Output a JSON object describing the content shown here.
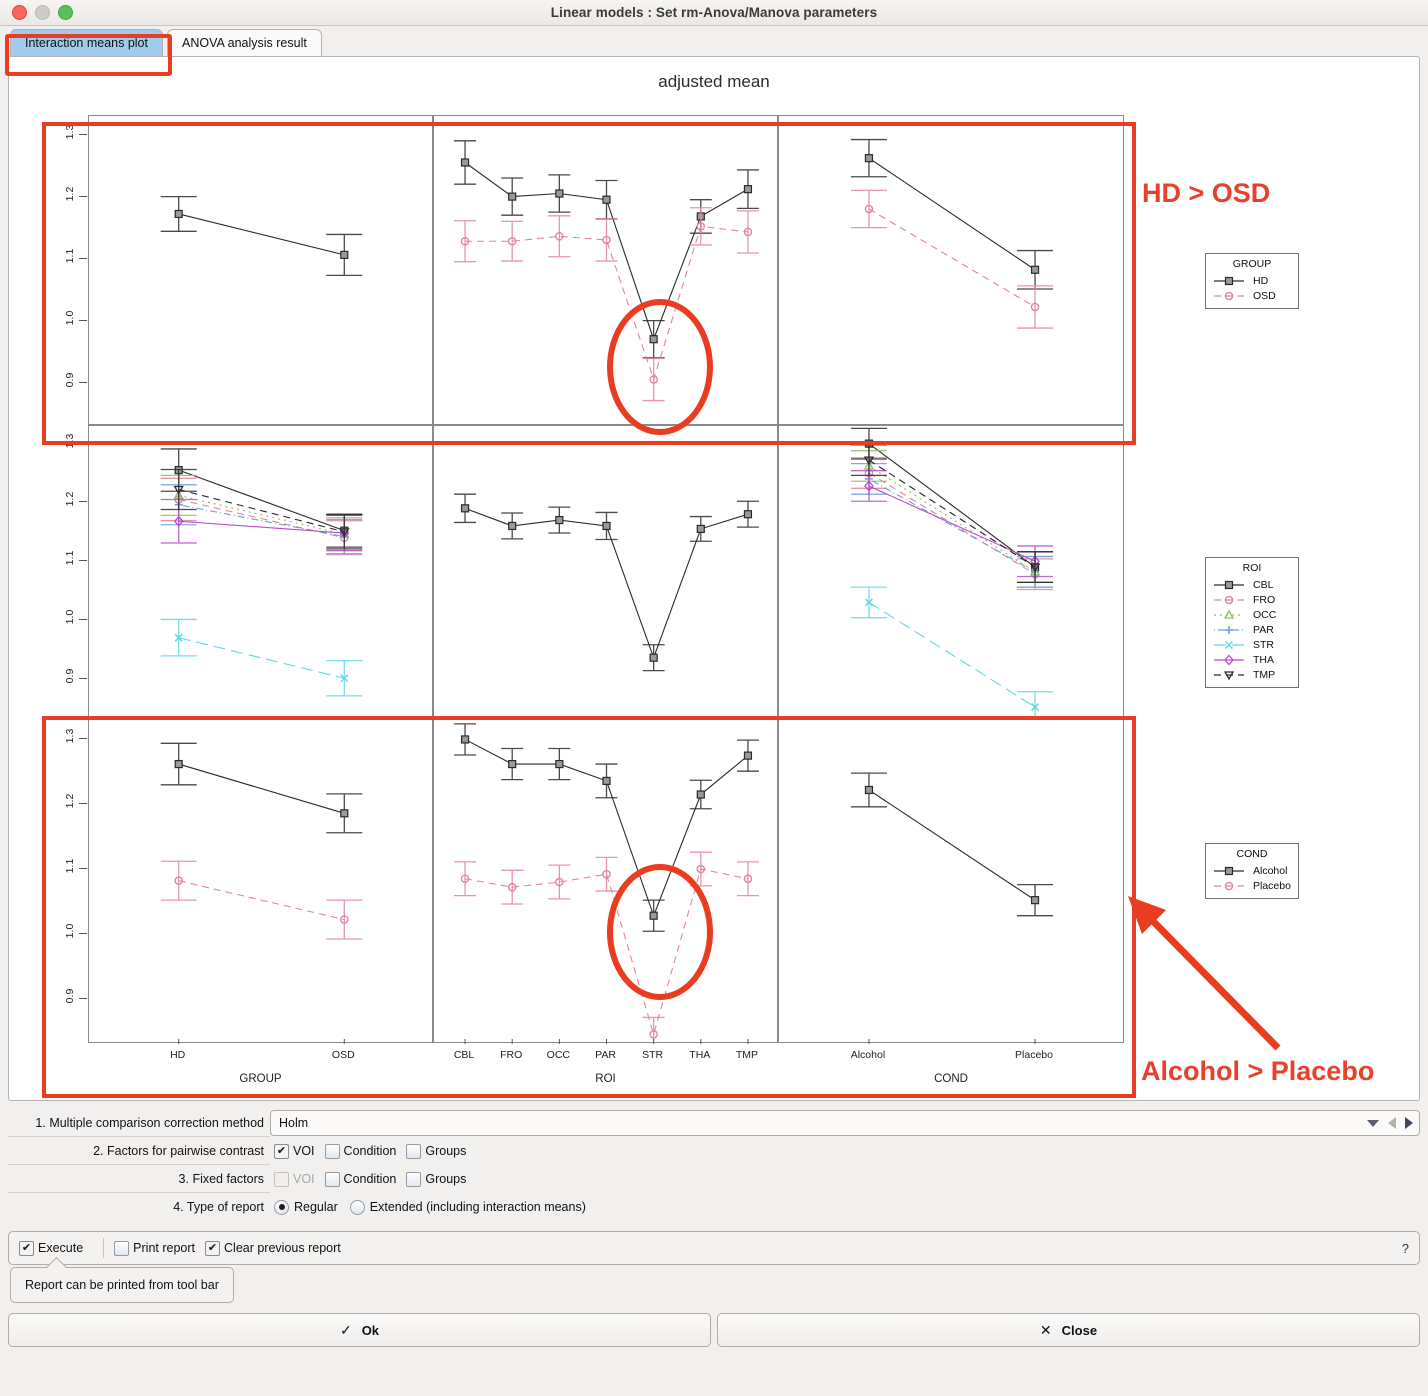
{
  "window": {
    "title": "Linear models :  Set rm-Anova/Manova parameters",
    "traffic": {
      "close": "close-button",
      "minimize": "minimize-button",
      "zoom": "zoom-button"
    }
  },
  "tabs": [
    {
      "label": "Interaction means plot",
      "active": true
    },
    {
      "label": "ANOVA analysis result",
      "active": false
    }
  ],
  "annotations": {
    "hd_osd": "HD > OSD",
    "alcohol_placebo": "Alcohol > Placebo"
  },
  "chart_data": {
    "type": "line",
    "title": "adjusted mean",
    "ylabel": "",
    "ylim": [
      0.83,
      1.33
    ],
    "yticks": [
      "0.9",
      "1.0",
      "1.1",
      "1.2",
      "1.3"
    ],
    "ytick_values": [
      0.9,
      1.0,
      1.1,
      1.2,
      1.3
    ],
    "grid": false,
    "columns": [
      {
        "name": "GROUP",
        "categories": [
          "HD",
          "OSD"
        ]
      },
      {
        "name": "ROI",
        "categories": [
          "CBL",
          "FRO",
          "OCC",
          "PAR",
          "STR",
          "THA",
          "TMP"
        ]
      },
      {
        "name": "COND",
        "categories": [
          "Alcohol",
          "Placebo"
        ]
      }
    ],
    "rows": [
      {
        "legend": {
          "title": "GROUP",
          "position": "right",
          "entries": [
            {
              "name": "HD",
              "color": "#2a2a2a",
              "marker": "square",
              "dash": "solid"
            },
            {
              "name": "OSD",
              "color": "#e2849f",
              "marker": "circle",
              "dash": "dashed"
            }
          ]
        },
        "panels": [
          {
            "x": "GROUP",
            "series": [
              {
                "name": "HD",
                "values": [
                  1.172,
                  1.106
                ],
                "err": [
                  0.028,
                  0.033
                ]
              }
            ]
          },
          {
            "x": "ROI",
            "series": [
              {
                "name": "HD",
                "values": [
                  1.255,
                  1.2,
                  1.205,
                  1.195,
                  0.97,
                  1.168,
                  1.212
                ],
                "err": [
                  0.035,
                  0.03,
                  0.03,
                  0.031,
                  0.03,
                  0.027,
                  0.031
                ]
              },
              {
                "name": "OSD",
                "values": [
                  1.128,
                  1.128,
                  1.136,
                  1.13,
                  0.905,
                  1.152,
                  1.143
                ],
                "err": [
                  0.033,
                  0.032,
                  0.033,
                  0.034,
                  0.034,
                  0.03,
                  0.034
                ]
              }
            ]
          },
          {
            "x": "COND",
            "series": [
              {
                "name": "HD",
                "values": [
                  1.262,
                  1.082
                ],
                "err": [
                  0.03,
                  0.031
                ]
              },
              {
                "name": "OSD",
                "values": [
                  1.18,
                  1.022
                ],
                "err": [
                  0.03,
                  0.034
                ]
              }
            ]
          }
        ]
      },
      {
        "legend": {
          "title": "ROI",
          "position": "right",
          "entries": [
            {
              "name": "CBL",
              "color": "#2a2a2a",
              "marker": "square",
              "dash": "solid"
            },
            {
              "name": "FRO",
              "color": "#e2849f",
              "marker": "circle",
              "dash": "dashed"
            },
            {
              "name": "OCC",
              "color": "#8fbf62",
              "marker": "triangle",
              "dash": "dotted"
            },
            {
              "name": "PAR",
              "color": "#6d9ede",
              "marker": "plus",
              "dash": "dotdash"
            },
            {
              "name": "STR",
              "color": "#61d8e2",
              "marker": "cross",
              "dash": "longdash"
            },
            {
              "name": "THA",
              "color": "#b84bc9",
              "marker": "diamond",
              "dash": "solid"
            },
            {
              "name": "TMP",
              "color": "#2a2a2a",
              "marker": "nabla",
              "dash": "dashed"
            }
          ]
        },
        "panels": [
          {
            "x": "GROUP",
            "series": [
              {
                "name": "CBL",
                "values": [
                  1.255,
                  1.152
                ],
                "err": [
                  0.036,
                  0.028
                ]
              },
              {
                "name": "FRO",
                "values": [
                  1.205,
                  1.14
                ],
                "err": [
                  0.036,
                  0.029
                ]
              },
              {
                "name": "OCC",
                "values": [
                  1.212,
                  1.146
                ],
                "err": [
                  0.034,
                  0.028
                ]
              },
              {
                "name": "PAR",
                "values": [
                  1.196,
                  1.142
                ],
                "err": [
                  0.034,
                  0.029
                ]
              },
              {
                "name": "STR",
                "values": [
                  0.97,
                  0.901
                ],
                "err": [
                  0.031,
                  0.03
                ]
              },
              {
                "name": "THA",
                "values": [
                  1.168,
                  1.148
                ],
                "err": [
                  0.037,
                  0.03
                ]
              },
              {
                "name": "TMP",
                "values": [
                  1.222,
                  1.15
                ],
                "err": [
                  0.034,
                  0.029
                ]
              }
            ]
          },
          {
            "x": "ROI",
            "series": [
              {
                "name": "CBL",
                "values": [
                  1.19,
                  1.16,
                  1.17,
                  1.16,
                  0.936,
                  1.155,
                  1.18
                ],
                "err": [
                  0.024,
                  0.022,
                  0.022,
                  0.023,
                  0.022,
                  0.021,
                  0.022
                ]
              }
            ]
          },
          {
            "x": "COND",
            "series": [
              {
                "name": "CBL",
                "values": [
                  1.3,
                  1.09
                ],
                "err": [
                  0.026,
                  0.026
                ]
              },
              {
                "name": "FRO",
                "values": [
                  1.25,
                  1.078
                ],
                "err": [
                  0.026,
                  0.026
                ]
              },
              {
                "name": "OCC",
                "values": [
                  1.262,
                  1.082
                ],
                "err": [
                  0.026,
                  0.026
                ]
              },
              {
                "name": "PAR",
                "values": [
                  1.24,
                  1.082
                ],
                "err": [
                  0.026,
                  0.026
                ]
              },
              {
                "name": "STR",
                "values": [
                  1.03,
                  0.852
                ],
                "err": [
                  0.026,
                  0.026
                ]
              },
              {
                "name": "THA",
                "values": [
                  1.228,
                  1.1
                ],
                "err": [
                  0.026,
                  0.026
                ]
              },
              {
                "name": "TMP",
                "values": [
                  1.272,
                  1.09
                ],
                "err": [
                  0.026,
                  0.026
                ]
              }
            ]
          }
        ]
      },
      {
        "legend": {
          "title": "COND",
          "position": "right",
          "entries": [
            {
              "name": "Alcohol",
              "color": "#2a2a2a",
              "marker": "square",
              "dash": "solid"
            },
            {
              "name": "Placebo",
              "color": "#e2849f",
              "marker": "circle",
              "dash": "dashed"
            }
          ]
        },
        "panels": [
          {
            "x": "GROUP",
            "series": [
              {
                "name": "Alcohol",
                "values": [
                  1.262,
                  1.186
                ],
                "err": [
                  0.032,
                  0.03
                ]
              },
              {
                "name": "Placebo",
                "values": [
                  1.082,
                  1.022
                ],
                "err": [
                  0.03,
                  0.03
                ]
              }
            ]
          },
          {
            "x": "ROI",
            "series": [
              {
                "name": "Alcohol",
                "values": [
                  1.3,
                  1.262,
                  1.262,
                  1.236,
                  1.028,
                  1.215,
                  1.275
                ],
                "err": [
                  0.024,
                  0.024,
                  0.024,
                  0.026,
                  0.024,
                  0.022,
                  0.024
                ]
              },
              {
                "name": "Placebo",
                "values": [
                  1.085,
                  1.072,
                  1.08,
                  1.092,
                  0.845,
                  1.1,
                  1.085
                ],
                "err": [
                  0.026,
                  0.026,
                  0.026,
                  0.026,
                  0.026,
                  0.026,
                  0.026
                ]
              }
            ]
          },
          {
            "x": "COND",
            "series": [
              {
                "name": "Alcohol",
                "values": [
                  1.222,
                  1.052
                ],
                "err": [
                  0.026,
                  0.024
                ]
              }
            ]
          }
        ]
      }
    ]
  },
  "controls": {
    "method": {
      "number": "1. Multiple comparison correction method",
      "value": "Holm"
    },
    "pairwise": {
      "number": "2. Factors for pairwise contrast",
      "options": [
        {
          "label": "VOI",
          "checked": true,
          "disabled": false
        },
        {
          "label": "Condition",
          "checked": false,
          "disabled": false
        },
        {
          "label": "Groups",
          "checked": false,
          "disabled": false
        }
      ]
    },
    "fixed": {
      "number": "3. Fixed factors",
      "options": [
        {
          "label": "VOI",
          "checked": false,
          "disabled": true
        },
        {
          "label": "Condition",
          "checked": false,
          "disabled": false
        },
        {
          "label": "Groups",
          "checked": false,
          "disabled": false
        }
      ]
    },
    "report": {
      "number": "4. Type of report",
      "options": [
        {
          "label": "Regular",
          "selected": true
        },
        {
          "label": "Extended (including interaction means)",
          "selected": false
        }
      ]
    }
  },
  "execbar": {
    "execute": {
      "label": "Execute",
      "checked": true
    },
    "print": {
      "label": "Print report",
      "checked": false
    },
    "clear": {
      "label": "Clear previous report",
      "checked": true
    },
    "help": "?"
  },
  "tooltip": "Report can be printed from tool bar",
  "buttons": {
    "ok": {
      "label": "Ok",
      "glyph": "✓"
    },
    "close": {
      "label": "Close",
      "glyph": "✕"
    }
  }
}
